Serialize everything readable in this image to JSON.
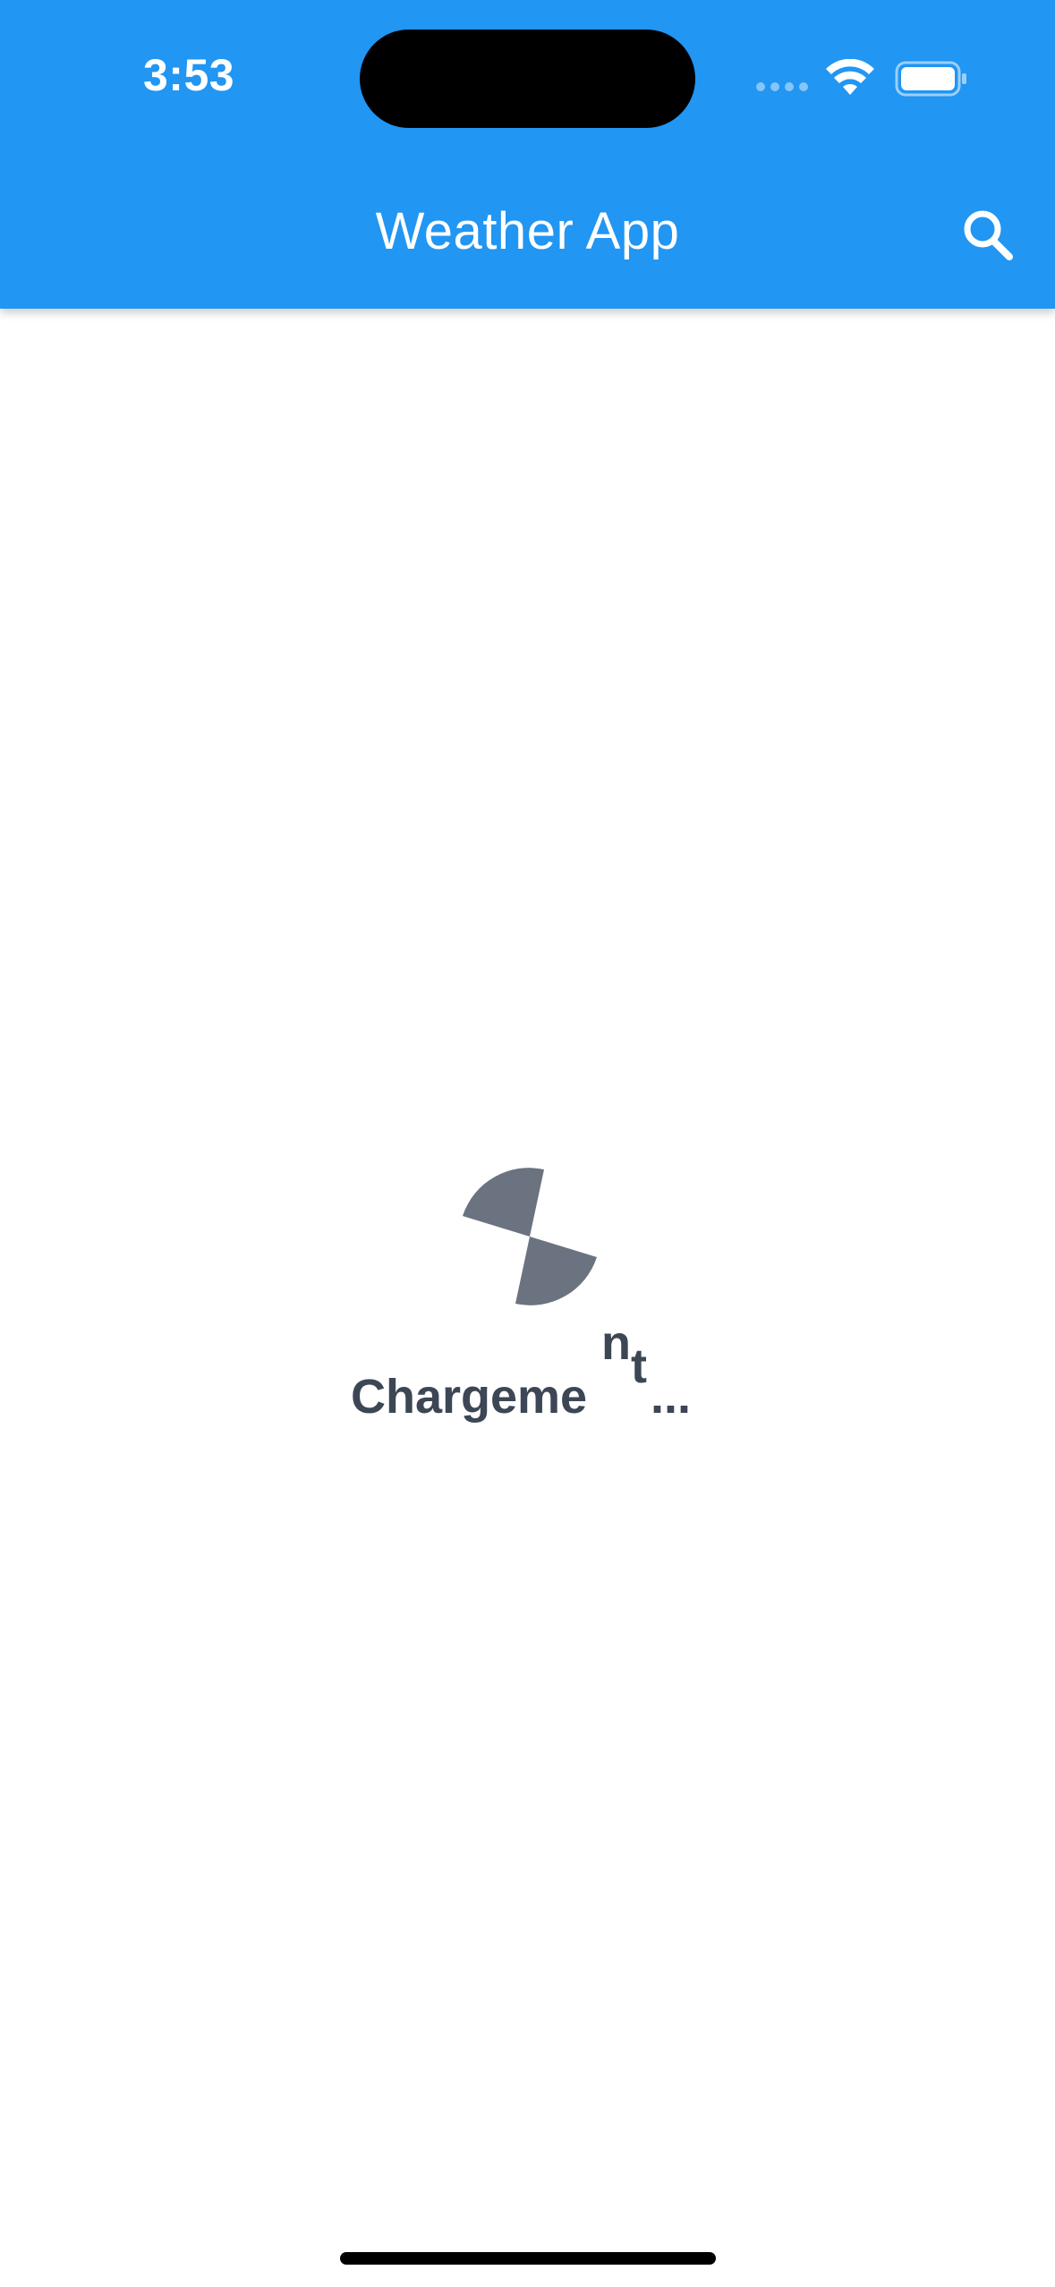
{
  "status_bar": {
    "time": "3:53"
  },
  "app_bar": {
    "title": "Weather App",
    "search_icon": "search-icon"
  },
  "loading": {
    "text_main": "Chargeme",
    "text_n": "n",
    "text_t": "t",
    "text_dots": "...",
    "spinner_icon": "loading-spinner-icon"
  },
  "colors": {
    "app_bar": "#2196F3",
    "loader": "#6b7280",
    "text": "#3d4654",
    "background": "#ffffff"
  }
}
